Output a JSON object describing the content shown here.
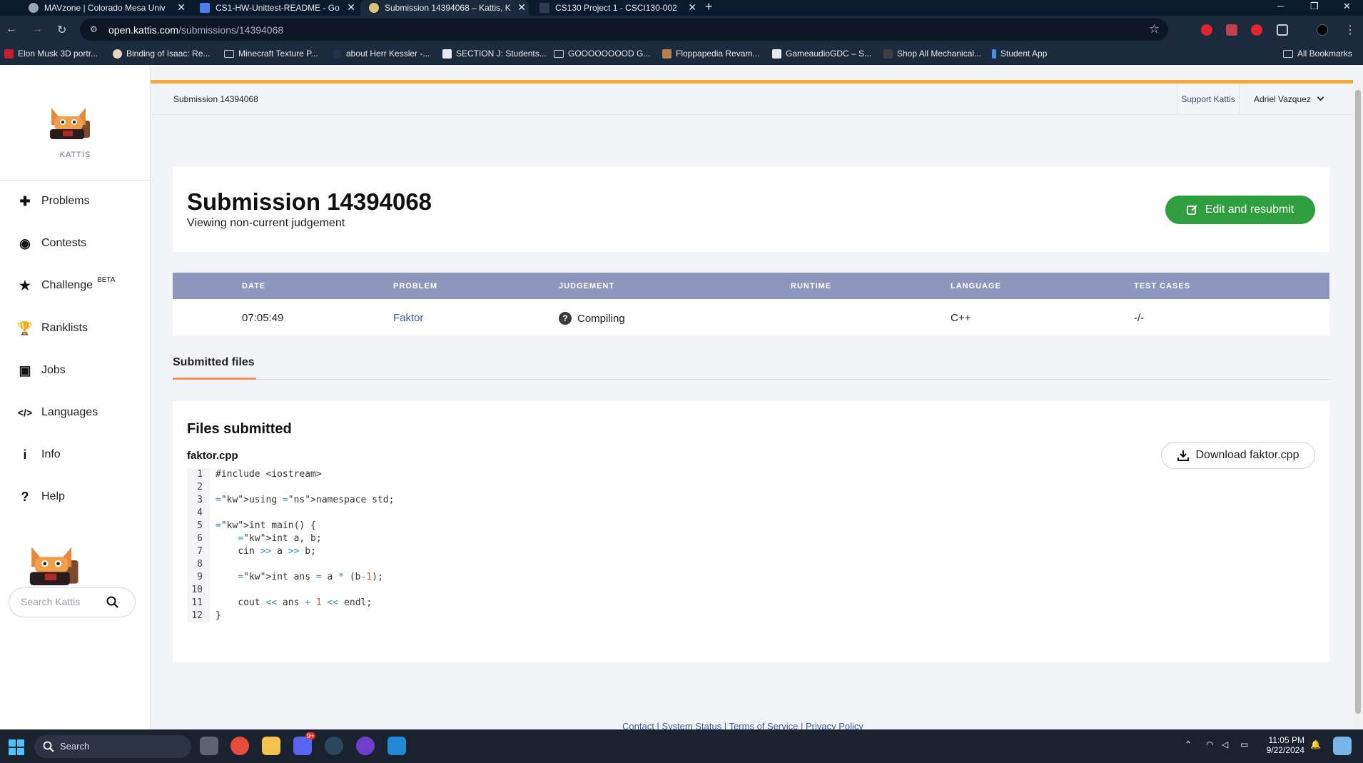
{
  "browser": {
    "tabs": [
      {
        "title": "MAVzone | Colorado Mesa Univ",
        "active": false
      },
      {
        "title": "CS1-HW-Unittest-README - Go",
        "active": false
      },
      {
        "title": "Submission 14394068 – Kattis, K",
        "active": true
      },
      {
        "title": "CS130 Project 1 - CSCI130-002",
        "active": false
      }
    ],
    "new_tab_label": "+",
    "url_host": "open.kattis.com",
    "url_path": "/submissions/14394068",
    "bookmarks": [
      "Elon Musk 3D portr...",
      "Binding of Isaac: Re...",
      "Minecraft Texture P...",
      "about Herr Kessler -...",
      "SECTION J: Students...",
      "GOOOOOOOOD G...",
      "Floppapedia Revam...",
      "GameaudioGDC – S...",
      "Shop All Mechanical...",
      "Student App"
    ],
    "all_bookmarks": "All Bookmarks"
  },
  "sidebar": {
    "logo_text": "KATTIS",
    "items": [
      {
        "label": "Problems",
        "icon": "puzzle-icon"
      },
      {
        "label": "Contests",
        "icon": "contest-icon"
      },
      {
        "label": "Challenge",
        "icon": "star-icon",
        "badge": "BETA"
      },
      {
        "label": "Ranklists",
        "icon": "trophy-icon"
      },
      {
        "label": "Jobs",
        "icon": "briefcase-icon"
      },
      {
        "label": "Languages",
        "icon": "code-icon"
      },
      {
        "label": "Info",
        "icon": "info-icon"
      },
      {
        "label": "Help",
        "icon": "question-icon"
      }
    ],
    "search_placeholder": "Search Kattis"
  },
  "topbar": {
    "breadcrumb": "Submission 14394068",
    "support": "Support Kattis",
    "user": "Adriel Vazquez"
  },
  "submission": {
    "title": "Submission 14394068",
    "subtitle": "Viewing non-current judgement",
    "resubmit_label": "Edit and resubmit"
  },
  "table": {
    "headers": [
      "DATE",
      "PROBLEM",
      "JUDGEMENT",
      "RUNTIME",
      "LANGUAGE",
      "TEST CASES"
    ],
    "row": {
      "date": "07:05:49",
      "problem": "Faktor",
      "judgement": "Compiling",
      "runtime": "",
      "language": "C++",
      "test_cases": "-/-"
    }
  },
  "files": {
    "tab_label": "Submitted files",
    "title": "Files submitted",
    "filename": "faktor.cpp",
    "download_label": "Download faktor.cpp",
    "code_lines": [
      "#include <iostream>",
      "",
      "using namespace std;",
      "",
      "int main() {",
      "    int a, b;",
      "    cin >> a >> b;",
      "",
      "    int ans = a * (b-1);",
      "",
      "    cout << ans + 1 << endl;",
      "}"
    ]
  },
  "footer": "Contact | System Status | Terms of Service | Privacy Policy",
  "taskbar": {
    "search_label": "Search",
    "time": "11:05 PM",
    "date": "9/22/2024",
    "discord_badge": "9+"
  },
  "colors": {
    "accent_orange": "#f4a836",
    "resubmit_green": "#2f9e3f",
    "table_header": "#8d97bd",
    "link_blue": "#3d5a9a"
  }
}
